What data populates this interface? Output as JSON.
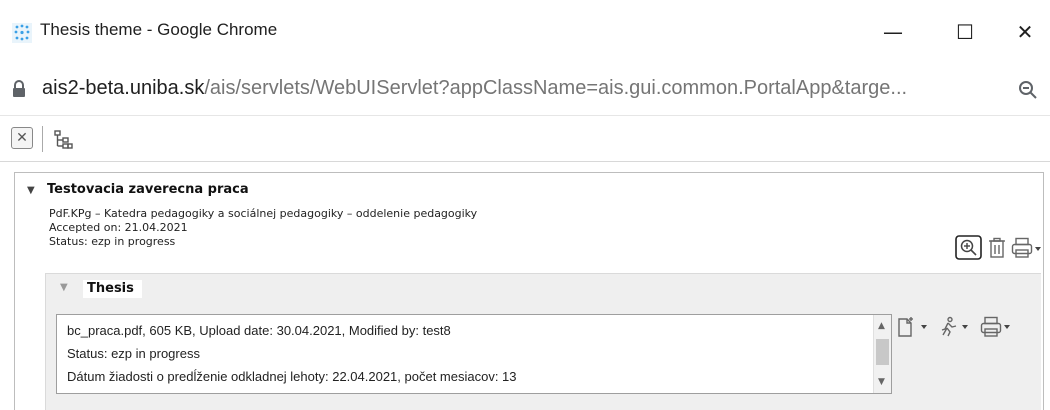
{
  "window": {
    "title": "Thesis theme - Google Chrome",
    "minimize_glyph": "—",
    "maximize_glyph": "☐",
    "close_glyph": "✕",
    "app_icon": "dots-app-icon"
  },
  "address": {
    "host": "ais2-beta.uniba.sk",
    "path": "/ais/servlets/WebUIServlet?appClassName=ais.gui.common.PortalApp&targe...",
    "lock_icon": "lock-icon",
    "zoom_icon": "zoom-icon"
  },
  "toolbar": {
    "close_glyph": "✕",
    "tree_icon": "tree-icon"
  },
  "section": {
    "title": "Testovacia zaverecna praca",
    "department": "PdF.KPg – Katedra pedagogiky a sociálnej pedagogiky – oddelenie pedagogiky",
    "accepted": "Accepted on: 21.04.2021",
    "status": "Status: ezp in progress",
    "icons": [
      "zoom-in-icon",
      "trash-icon",
      "print-icon"
    ]
  },
  "thesis": {
    "title": "Thesis",
    "file_lines": [
      "bc_praca.pdf, 605 KB, Upload date: 30.04.2021, Modified by: test8",
      "Status: ezp in progress",
      "Dátum žiadosti o predĺženie odkladnej lehoty: 22.04.2021, počet mesiacov: 13"
    ],
    "icons": [
      "new-document-icon",
      "run-icon",
      "print-icon"
    ]
  },
  "colors": {
    "icon_blue": "#3aa0e6",
    "border": "#9e9e9e",
    "panel_bg": "#efefef"
  }
}
